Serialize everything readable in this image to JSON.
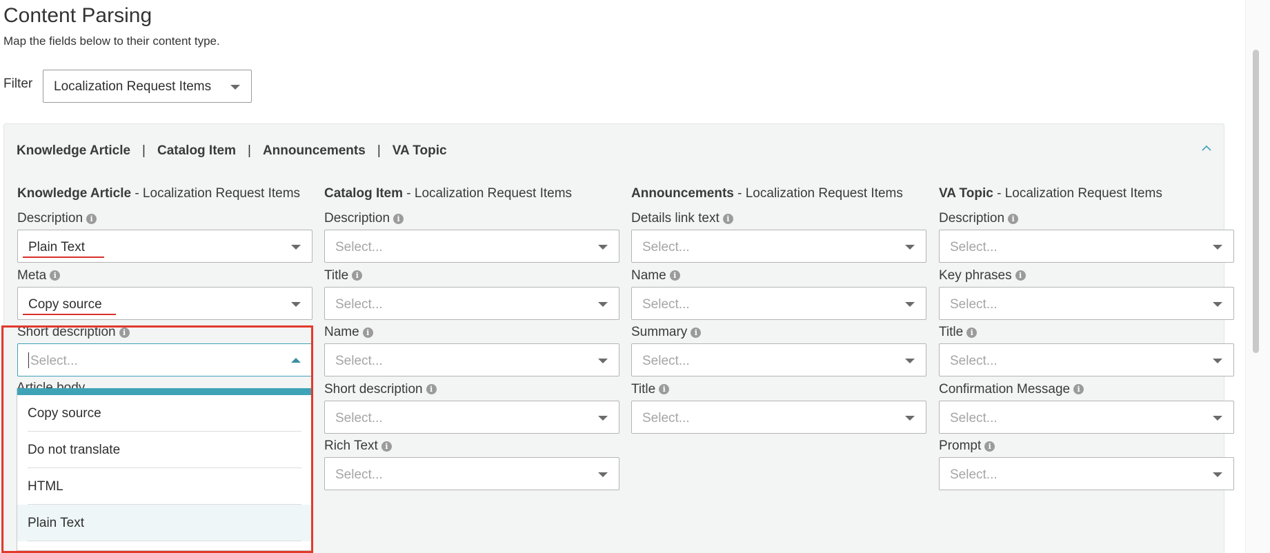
{
  "page": {
    "title": "Content Parsing",
    "subtitle": "Map the fields below to their content type.",
    "filter_label": "Filter",
    "filter_value": "Localization Request Items"
  },
  "tabs": [
    "Knowledge Article",
    "Catalog Item",
    "Announcements",
    "VA Topic"
  ],
  "tab_separator": "|",
  "columns": [
    {
      "name": "Knowledge Article",
      "suffix": " - Localization Request Items",
      "fields": [
        {
          "label": "Description",
          "value": "Plain Text"
        },
        {
          "label": "Meta",
          "value": "Copy source"
        },
        {
          "label": "Short description",
          "placeholder": "Select..."
        }
      ]
    },
    {
      "name": "Catalog Item",
      "suffix": " - Localization Request Items",
      "fields": [
        {
          "label": "Description",
          "placeholder": "Select..."
        },
        {
          "label": "Title",
          "placeholder": "Select..."
        },
        {
          "label": "Name",
          "placeholder": "Select..."
        },
        {
          "label": "Short description",
          "placeholder": "Select..."
        },
        {
          "label": "Rich Text",
          "placeholder": "Select..."
        }
      ]
    },
    {
      "name": "Announcements",
      "suffix": " - Localization Request Items",
      "fields": [
        {
          "label": "Details link text",
          "placeholder": "Select..."
        },
        {
          "label": "Name",
          "placeholder": "Select..."
        },
        {
          "label": "Summary",
          "placeholder": "Select..."
        },
        {
          "label": "Title",
          "placeholder": "Select..."
        }
      ]
    },
    {
      "name": "VA Topic",
      "suffix": " - Localization Request Items",
      "fields": [
        {
          "label": "Description",
          "placeholder": "Select..."
        },
        {
          "label": "Key phrases",
          "placeholder": "Select..."
        },
        {
          "label": "Title",
          "placeholder": "Select..."
        },
        {
          "label": "Confirmation Message",
          "placeholder": "Select..."
        },
        {
          "label": "Prompt",
          "placeholder": "Select..."
        }
      ]
    }
  ],
  "hidden_field_label": "Article body",
  "dropdown": {
    "options": [
      "Copy source",
      "Do not translate",
      "HTML",
      "Plain Text"
    ],
    "highlighted": "Plain Text"
  },
  "colors": {
    "accent": "#3ea3b6",
    "annotation": "#e23a2b"
  }
}
